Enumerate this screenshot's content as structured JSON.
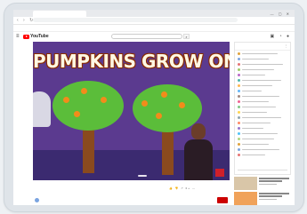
{
  "browser": {
    "url": "",
    "bookmarks": [
      "",
      "",
      "",
      "",
      "",
      "",
      "",
      "",
      "",
      ""
    ]
  },
  "youtube": {
    "wordmark": "YouTube"
  },
  "video": {
    "overlay_title": "PUMPKINS GROW ON TREES."
  },
  "meta": {
    "channel_tag": "",
    "title": "",
    "stats": ""
  },
  "owner": {
    "name": "",
    "subscribe_label": ""
  },
  "chat": {
    "header": "",
    "message_dot_colors": [
      "#e0a23b",
      "#7aa4e0",
      "#e57373",
      "#9ccc65",
      "#ba68c8",
      "#4db6ac",
      "#ffb74d",
      "#64b5f6",
      "#a1887f",
      "#f06292",
      "#81c784",
      "#ffd54f",
      "#90a4ae",
      "#ff8a65",
      "#9575cd",
      "#4fc3f7",
      "#aed581",
      "#e0a23b",
      "#7aa4e0",
      "#e57373"
    ]
  },
  "show_more_link": "",
  "colors": {
    "youtube_red": "#ff0000",
    "video_bg": "#5b3a8f",
    "tree_green": "#5bbd3a",
    "pumpkin_orange": "#f28c1a"
  }
}
